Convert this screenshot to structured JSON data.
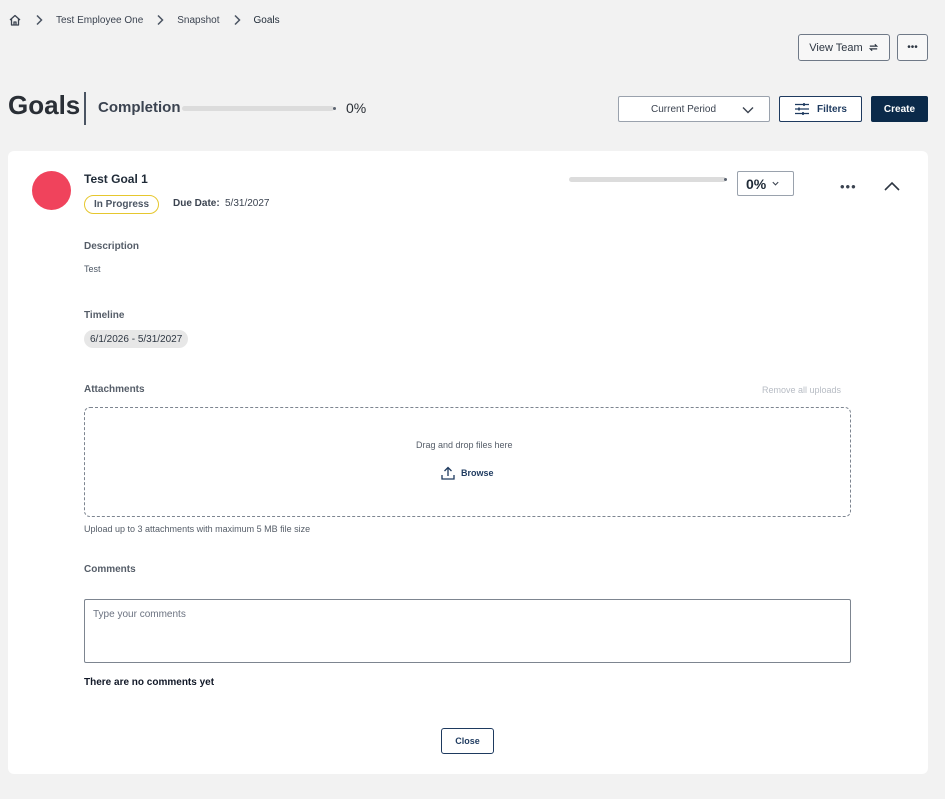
{
  "breadcrumb": {
    "home_icon": "home-icon",
    "items": [
      "Test Employee One",
      "Snapshot",
      "Goals"
    ]
  },
  "header": {
    "view_team_label": "View Team",
    "view_team_icon": "refresh-icon",
    "more_label": "•••"
  },
  "page": {
    "title": "Goals",
    "completion_label": "Completion",
    "completion_value": "0%",
    "completion_progress": 0
  },
  "toolbar": {
    "period_value": "Current Period",
    "filters_label": "Filters",
    "create_label": "Create"
  },
  "goal": {
    "title": "Test Goal 1",
    "avatar_color": "#f0435c",
    "status": "In Progress",
    "due_label": "Due Date:",
    "due_value": "5/31/2027",
    "progress_value": "0%",
    "progress": 0,
    "more_label": "•••",
    "description_label": "Description",
    "description_value": "Test",
    "timeline_label": "Timeline",
    "timeline_value": "6/1/2026 - 5/31/2027",
    "attachments_label": "Attachments",
    "remove_all_label": "Remove all uploads",
    "drop_text": "Drag and drop files here",
    "browse_label": "Browse",
    "upload_hint": "Upload up to 3 attachments with maximum 5 MB file size",
    "comments_label": "Comments",
    "comments_placeholder": "Type your comments",
    "no_comments": "There are no comments yet",
    "close_label": "Close"
  },
  "colors": {
    "primary": "#0b2a4a",
    "status_border": "#e6c72e",
    "background": "#f2f2f2"
  }
}
